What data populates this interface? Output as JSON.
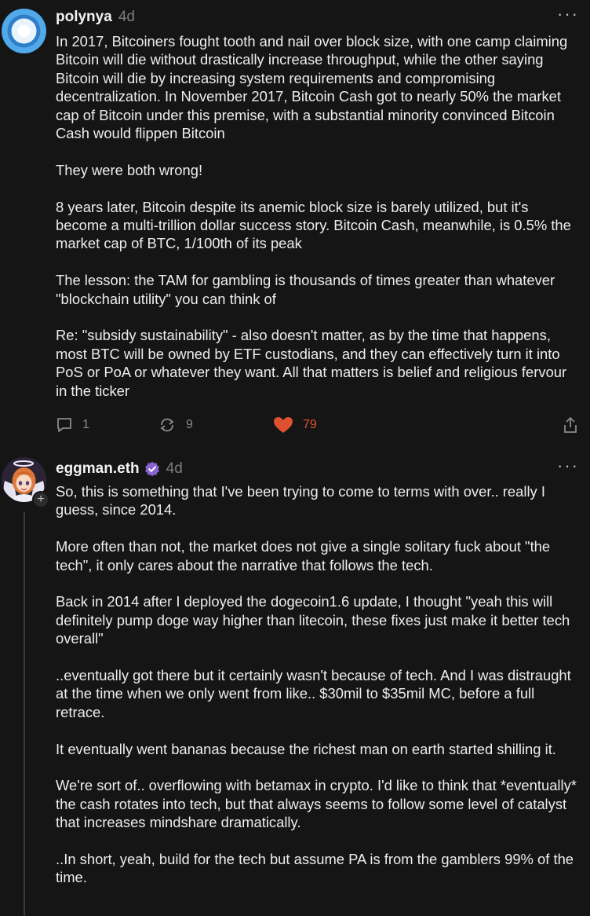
{
  "posts": [
    {
      "username": "polynya",
      "time": "4d",
      "more": "···",
      "paragraphs": [
        "In 2017, Bitcoiners fought tooth and nail over block size, with one camp claiming Bitcoin will die without drastically increase throughput, while the other saying Bitcoin will die by increasing system requirements and compromising decentralization. In November 2017, Bitcoin Cash got to nearly 50% the market cap of Bitcoin under this premise, with a substantial minority convinced Bitcoin Cash would flippen Bitcoin",
        "They were both wrong!",
        "8 years later, Bitcoin despite its anemic block size is barely utilized, but it's become a multi-trillion dollar success story. Bitcoin Cash, meanwhile, is 0.5% the market cap of BTC, 1/100th of its peak",
        "The lesson: the TAM for gambling is thousands of times greater than whatever \"blockchain utility\" you can think of",
        "Re: \"subsidy sustainability\" - also doesn't matter, as by the time that happens, most BTC will be owned by ETF custodians, and they can effectively turn it into PoS or PoA or whatever they want. All that matters is belief and religious fervour in the ticker"
      ],
      "replies": "1",
      "recasts": "9",
      "likes": "79"
    },
    {
      "username": "eggman.eth",
      "time": "4d",
      "more": "···",
      "add_badge": "+",
      "paragraphs": [
        "So, this is something that I've been trying to come to terms with over.. really I guess, since 2014.",
        "More often than not, the market does not give a single solitary fuck about \"the tech\", it only cares about the narrative that follows the tech.",
        "Back in 2014 after I deployed the dogecoin1.6 update, I thought \"yeah this will definitely pump doge way higher than litecoin, these fixes just make it better tech overall\"",
        "..eventually got there but it certainly wasn't because of tech. And I was distraught at the time when we only went from like.. $30mil to $35mil MC, before a full retrace.",
        "It eventually went bananas because the richest man on earth started shilling it.",
        "We're sort of.. overflowing with betamax in crypto. I'd like to think that *eventually* the cash rotates into tech, but that always seems to follow some level of catalyst that increases mindshare dramatically.",
        "..In short, yeah, build for the tech but assume PA is from the gamblers 99% of the time."
      ]
    }
  ],
  "colors": {
    "background": "#151515",
    "text": "#ededed",
    "muted": "#8a8a8a",
    "like": "#e0522f",
    "verified": "#8a63d2",
    "avatar_ring": "#5aa6e6"
  }
}
